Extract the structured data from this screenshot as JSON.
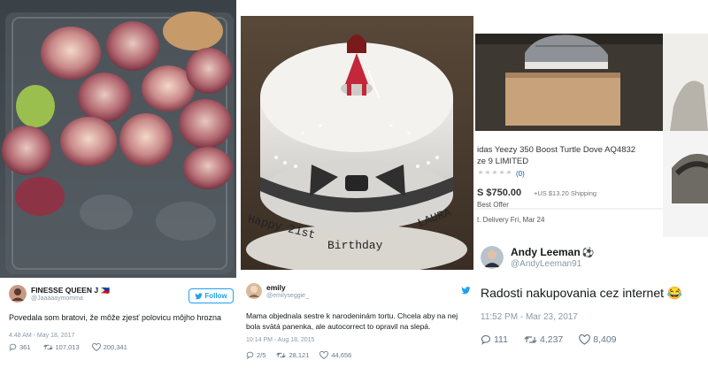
{
  "tweet1": {
    "name": "FINESSE QUEEN J",
    "flag": "🇵🇭",
    "handle": "@Jaaaaaymomma",
    "follow": "Follow",
    "text": "Povedala som bratovi, že môže zjesť polovicu môjho hrozna",
    "time": "4:48 AM - May 18, 2017",
    "replies": "361",
    "retweets": "107,013",
    "likes": "200,341"
  },
  "tweet2": {
    "name": "emily",
    "handle": "@emilyseggie_",
    "text": "Mama objednala sestre k narodeninám tortu. Chcela aby na nej bola svätá panenka, ale autocorrect to opravil na slepá.",
    "time": "10:14 PM - Aug 18, 2015",
    "replies": "2/5",
    "retweets": "28,121",
    "likes": "44,656",
    "cake_lines": [
      "Happy 21st",
      "Birthday",
      "LAURA"
    ]
  },
  "tweet3": {
    "name": "Andy Leeman",
    "badge": "⚽",
    "handle": "@AndyLeeman91",
    "text": "Radosti nakupovania cez internet 😂",
    "time": "11:52 PM - Mar 23, 2017",
    "replies": "111",
    "retweets": "4,237",
    "likes": "8,409",
    "listing": {
      "title_line1": "idas Yeezy 350 Boost Turtle Dove AQ4832",
      "title_line2": "ze 9 LIMITED",
      "rating": "(0)",
      "price": "S $750.00",
      "shipping": "+US $13.20 Shipping",
      "offer": "Best Offer",
      "delivery": "t. Delivery Fri, Mar 24"
    }
  },
  "colors": {
    "twitter_blue": "#1da1f2",
    "text_dark": "#14171a",
    "text_gray": "#8899a6",
    "listing_price": "#333333"
  }
}
